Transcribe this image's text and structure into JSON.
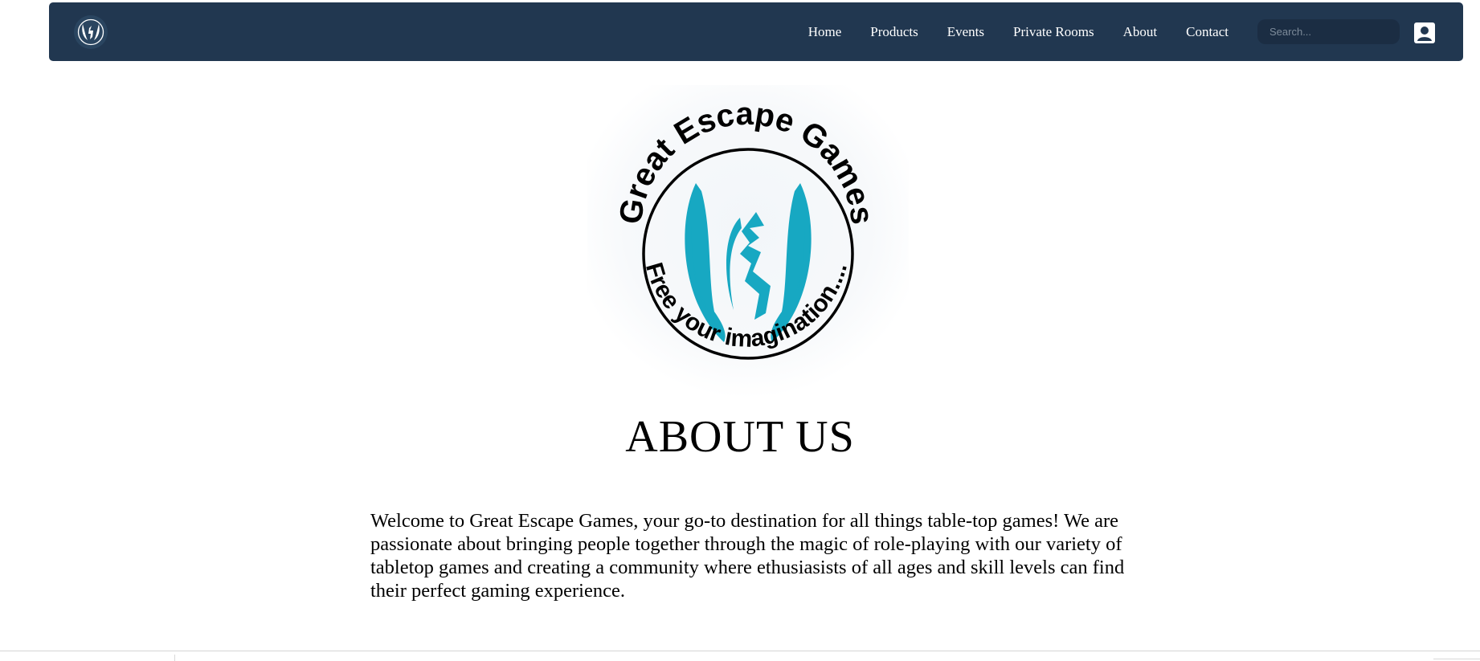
{
  "brand": {
    "name": "Great Escape Games",
    "tagline": "Free your imagination....",
    "accent_color": "#17a8c2",
    "navbar_color": "#213750"
  },
  "nav": {
    "links": [
      {
        "label": "Home"
      },
      {
        "label": "Products"
      },
      {
        "label": "Events"
      },
      {
        "label": "Private Rooms"
      },
      {
        "label": "About"
      },
      {
        "label": "Contact"
      }
    ],
    "search": {
      "placeholder": "Search...",
      "value": ""
    },
    "account_icon": "user-square-icon"
  },
  "about": {
    "heading": "ABOUT US",
    "body": "Welcome to Great Escape Games, your go-to destination for all things table-top games! We are passionate about bringing people together through the magic of role-playing with our variety of tabletop games and creating a community where ethusiasists of all ages and skill levels can find their perfect gaming experience."
  }
}
